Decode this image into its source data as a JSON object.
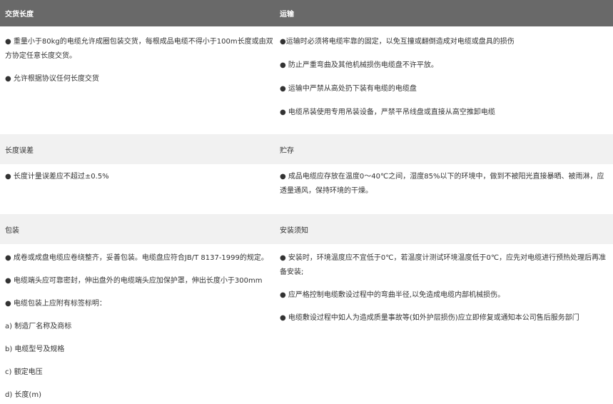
{
  "sections": [
    {
      "style": "head",
      "left_title": "交货长度",
      "right_title": "运输",
      "left_items": [
        "● 重量小于80kg的电缆允许成圈包装交货，每根成品电缆不得小于100m长度或由双方协定任意长度交货。",
        "● 允许根据协议任何长度交货"
      ],
      "right_items": [
        "●运输时必须将电缆牢靠的固定，以免互撞或翻倒造成对电缆或盘具的损伤",
        "● 防止严重弯曲及其他机械损伤电缆盘不许平放。",
        "● 运输中严禁从高处扔下装有电缆的电缆盘",
        "● 电缆吊装使用专用吊装设备，严禁平吊线盘或直接从高空推卸电缆"
      ]
    },
    {
      "style": "sub",
      "left_title": "长度误差",
      "right_title": "贮存",
      "left_items": [
        "● 长度计量误差应不超过±0.5%"
      ],
      "right_items": [
        "● 成品电缆应存放在温度0～40℃之间，湿度85%以下的环境中，做到不被阳光直接暴晒、被雨淋，应透量通风，保持环境的干燥。"
      ]
    },
    {
      "style": "sub",
      "left_title": "包装",
      "right_title": "安装须知",
      "left_items": [
        "● 成卷或成盘电缆应卷绕整齐，妥善包装。电缆盘应符合JB/T 8137-1999的规定。",
        "● 电缆端头应可靠密封，伸出盘外的电缆端头应加保护罩，伸出长度小于300mm",
        "● 电缆包装上应附有标签标明：",
        "a) 制造厂名称及商标",
        "b) 电缆型号及规格",
        "c) 额定电压",
        "d) 长度(m)"
      ],
      "right_items": [
        "● 安装时，环境温度应不宜低于0℃，若温度计测试环境温度低于0℃，应先对电缆进行预热处理后再准备安装;",
        "● 应严格控制电缆敷设过程中的弯曲半径,以免造成电缆内部机械损伤。",
        "● 电缆敷设过程中如人为造成质量事故等(如外护层损伤)应立即修复或通知本公司售后服务部门"
      ]
    }
  ]
}
